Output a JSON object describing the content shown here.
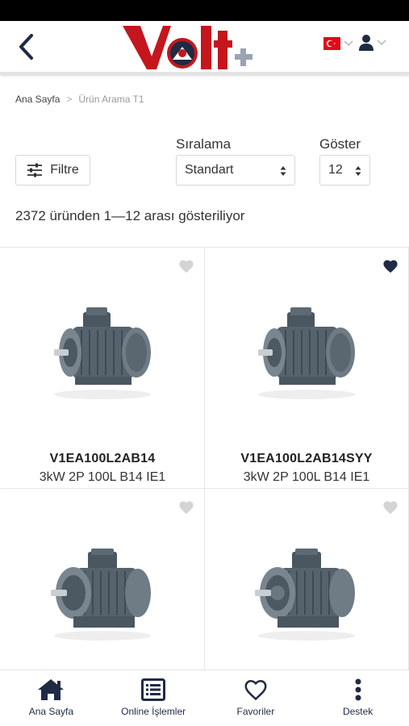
{
  "header": {
    "logo_text": "Volt+",
    "language": "TR",
    "colors": {
      "brand_red": "#c4161c",
      "brand_navy": "#1f2a44"
    }
  },
  "breadcrumb": {
    "home": "Ana Sayfa",
    "separator": ">",
    "current": "Ürün Arama T1"
  },
  "controls": {
    "filter_label": "Filtre",
    "sort_label": "Sıralama",
    "sort_value": "Standart",
    "show_label": "Göster",
    "show_value": "12"
  },
  "results": {
    "summary": "2372 üründen 1—12 arası gösteriliyor"
  },
  "products": [
    {
      "code": "V1EA100L2AB14",
      "desc": "3kW 2P 100L B14 IE1",
      "favorite": false,
      "image_icon": "electric-motor-image"
    },
    {
      "code": "V1EA100L2AB14SYY",
      "desc": "3kW 2P 100L B14 IE1",
      "favorite": true,
      "image_icon": "electric-motor-image"
    },
    {
      "code": "",
      "desc": "",
      "favorite": false,
      "image_icon": "electric-motor-image"
    },
    {
      "code": "",
      "desc": "",
      "favorite": false,
      "image_icon": "electric-motor-image"
    }
  ],
  "bottom_nav": [
    {
      "label": "Ana Sayfa",
      "icon": "home-icon"
    },
    {
      "label": "Online İşlemler",
      "icon": "list-icon"
    },
    {
      "label": "Favoriler",
      "icon": "heart-icon"
    },
    {
      "label": "Destek",
      "icon": "more-vertical-icon"
    }
  ]
}
